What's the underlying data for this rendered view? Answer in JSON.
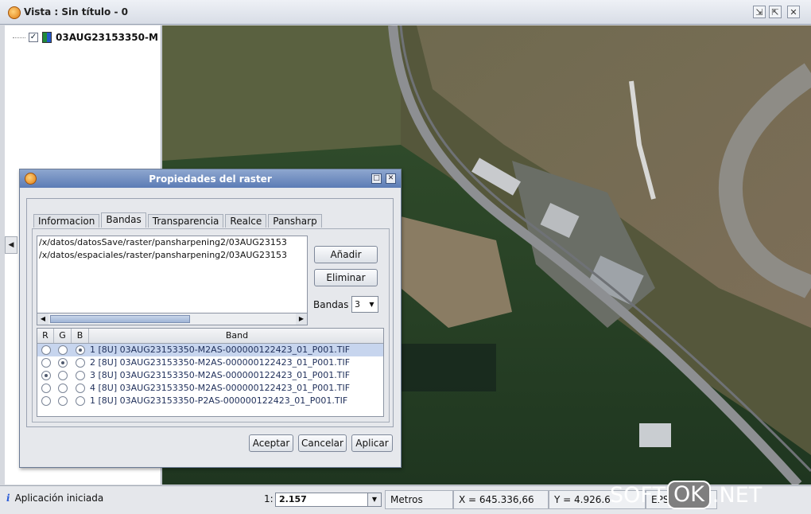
{
  "window": {
    "title": "Vista : Sin título  - 0",
    "btn_iconify": "⇲",
    "btn_maximize": "⇱",
    "btn_close": "✕"
  },
  "toc": {
    "layer_name": "03AUG23153350-M",
    "layer_checked": "✓",
    "collapse_arrow": "◀"
  },
  "dialog": {
    "title": "Propiedades del raster",
    "btn_maximize": "□",
    "btn_close": "✕",
    "tabs": [
      "Informacion",
      "Bandas",
      "Transparencia",
      "Realce",
      "Pansharp"
    ],
    "active_tab": "Bandas",
    "files": [
      "/x/datos/datosSave/raster/pansharpening2/03AUG23153",
      "/x/datos/espaciales/raster/pansharpening2/03AUG23153"
    ],
    "btn_add": "Añadir",
    "btn_remove": "Eliminar",
    "bandas_label": "Bandas",
    "bandas_value": "3",
    "scroll_left": "◀",
    "scroll_right": "▶",
    "combo_arrow": "▼",
    "table": {
      "headers": [
        "R",
        "G",
        "B",
        "Band"
      ],
      "rows": [
        {
          "r": false,
          "g": false,
          "b": true,
          "label": "1 [8U] 03AUG23153350-M2AS-000000122423_01_P001.TIF"
        },
        {
          "r": false,
          "g": true,
          "b": false,
          "label": "2 [8U] 03AUG23153350-M2AS-000000122423_01_P001.TIF"
        },
        {
          "r": true,
          "g": false,
          "b": false,
          "label": "3 [8U] 03AUG23153350-M2AS-000000122423_01_P001.TIF"
        },
        {
          "r": false,
          "g": false,
          "b": false,
          "label": "4 [8U] 03AUG23153350-M2AS-000000122423_01_P001.TIF"
        },
        {
          "r": false,
          "g": false,
          "b": false,
          "label": "1 [8U] 03AUG23153350-P2AS-000000122423_01_P001.TIF"
        }
      ]
    },
    "btn_accept": "Aceptar",
    "btn_cancel": "Cancelar",
    "btn_apply": "Aplicar"
  },
  "statusbar": {
    "info_icon": "i",
    "message": "Aplicación iniciada",
    "scale_prefix": "1:",
    "scale_value": "2.157",
    "units": "Metros",
    "x_coord": "X = 645.336,66",
    "y_coord": "Y = 4.926.6",
    "epsg": "EPSG:23",
    "combo_arrow": "▼"
  },
  "watermark": {
    "part1": "SOFT",
    "part2": "OK",
    "part3": ".NET"
  }
}
